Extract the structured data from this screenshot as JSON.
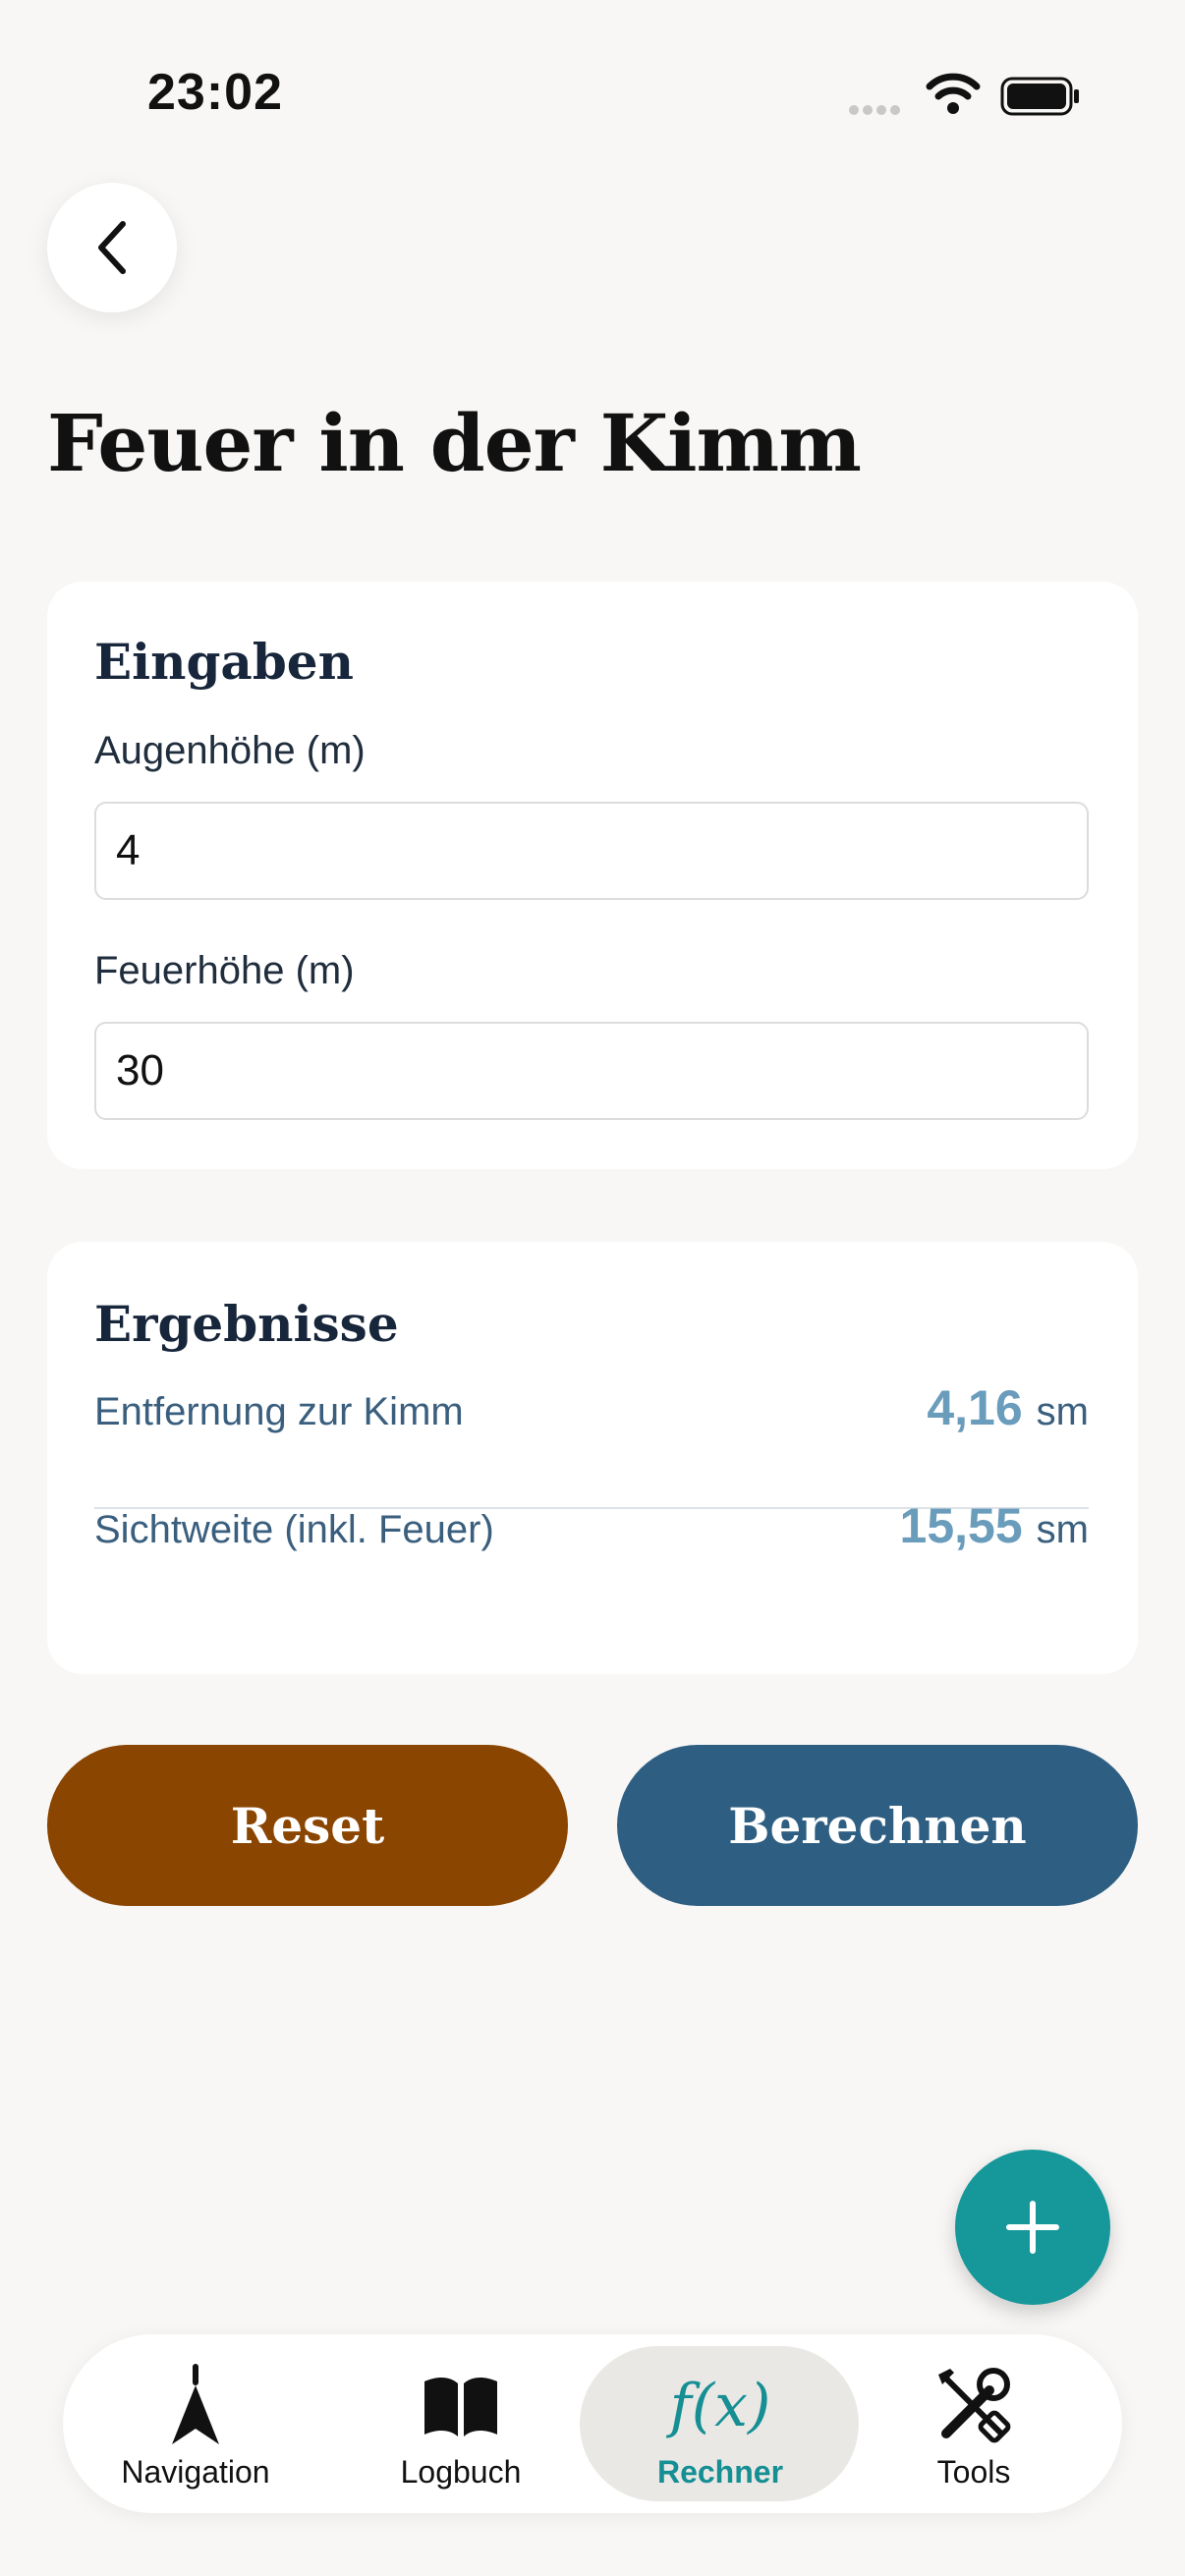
{
  "status_bar": {
    "time": "23:02"
  },
  "header": {
    "title": "Feuer in der Kimm"
  },
  "inputs": {
    "title": "Eingaben",
    "eye_height": {
      "label": "Augenhöhe (m)",
      "value": "4"
    },
    "light_height": {
      "label": "Feuerhöhe (m)",
      "value": "30"
    }
  },
  "results": {
    "title": "Ergebnisse",
    "rows": [
      {
        "label": "Entfernung zur Kimm",
        "value": "4,16",
        "unit": "sm"
      },
      {
        "label": "Sichtweite (inkl. Feuer)",
        "value": "15,55",
        "unit": "sm"
      }
    ]
  },
  "actions": {
    "reset_label": "Reset",
    "calculate_label": "Berechnen"
  },
  "tabbar": {
    "items": [
      {
        "label": "Navigation",
        "icon": "navigation-arrow-icon"
      },
      {
        "label": "Logbuch",
        "icon": "book-icon"
      },
      {
        "label": "Rechner",
        "icon": "function-icon",
        "glyph": "f(x)",
        "active": true
      },
      {
        "label": "Tools",
        "icon": "tools-icon"
      }
    ]
  },
  "colors": {
    "background": "#F8F7F5",
    "reset": "#8A4500",
    "calculate": "#2E5F82",
    "accent": "#16979A",
    "result_value": "#6A9CBC"
  }
}
